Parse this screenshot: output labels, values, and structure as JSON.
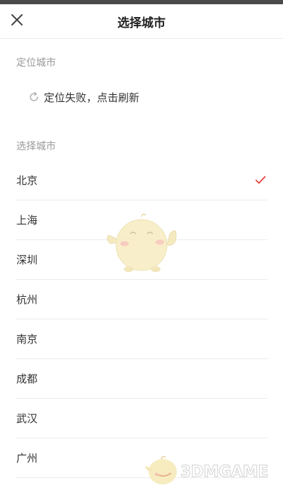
{
  "header": {
    "title": "选择城市",
    "close_icon": "close-icon"
  },
  "location": {
    "section_label": "定位城市",
    "status_text": "定位失败，点击刷新",
    "icon": "refresh-icon"
  },
  "select": {
    "section_label": "选择城市",
    "selected_city": "北京",
    "check_color": "#e64340",
    "cities": [
      {
        "name": "北京"
      },
      {
        "name": "上海"
      },
      {
        "name": "深圳"
      },
      {
        "name": "杭州"
      },
      {
        "name": "南京"
      },
      {
        "name": "成都"
      },
      {
        "name": "武汉"
      },
      {
        "name": "广州"
      }
    ]
  },
  "watermark": {
    "text": "3DMGAME"
  }
}
